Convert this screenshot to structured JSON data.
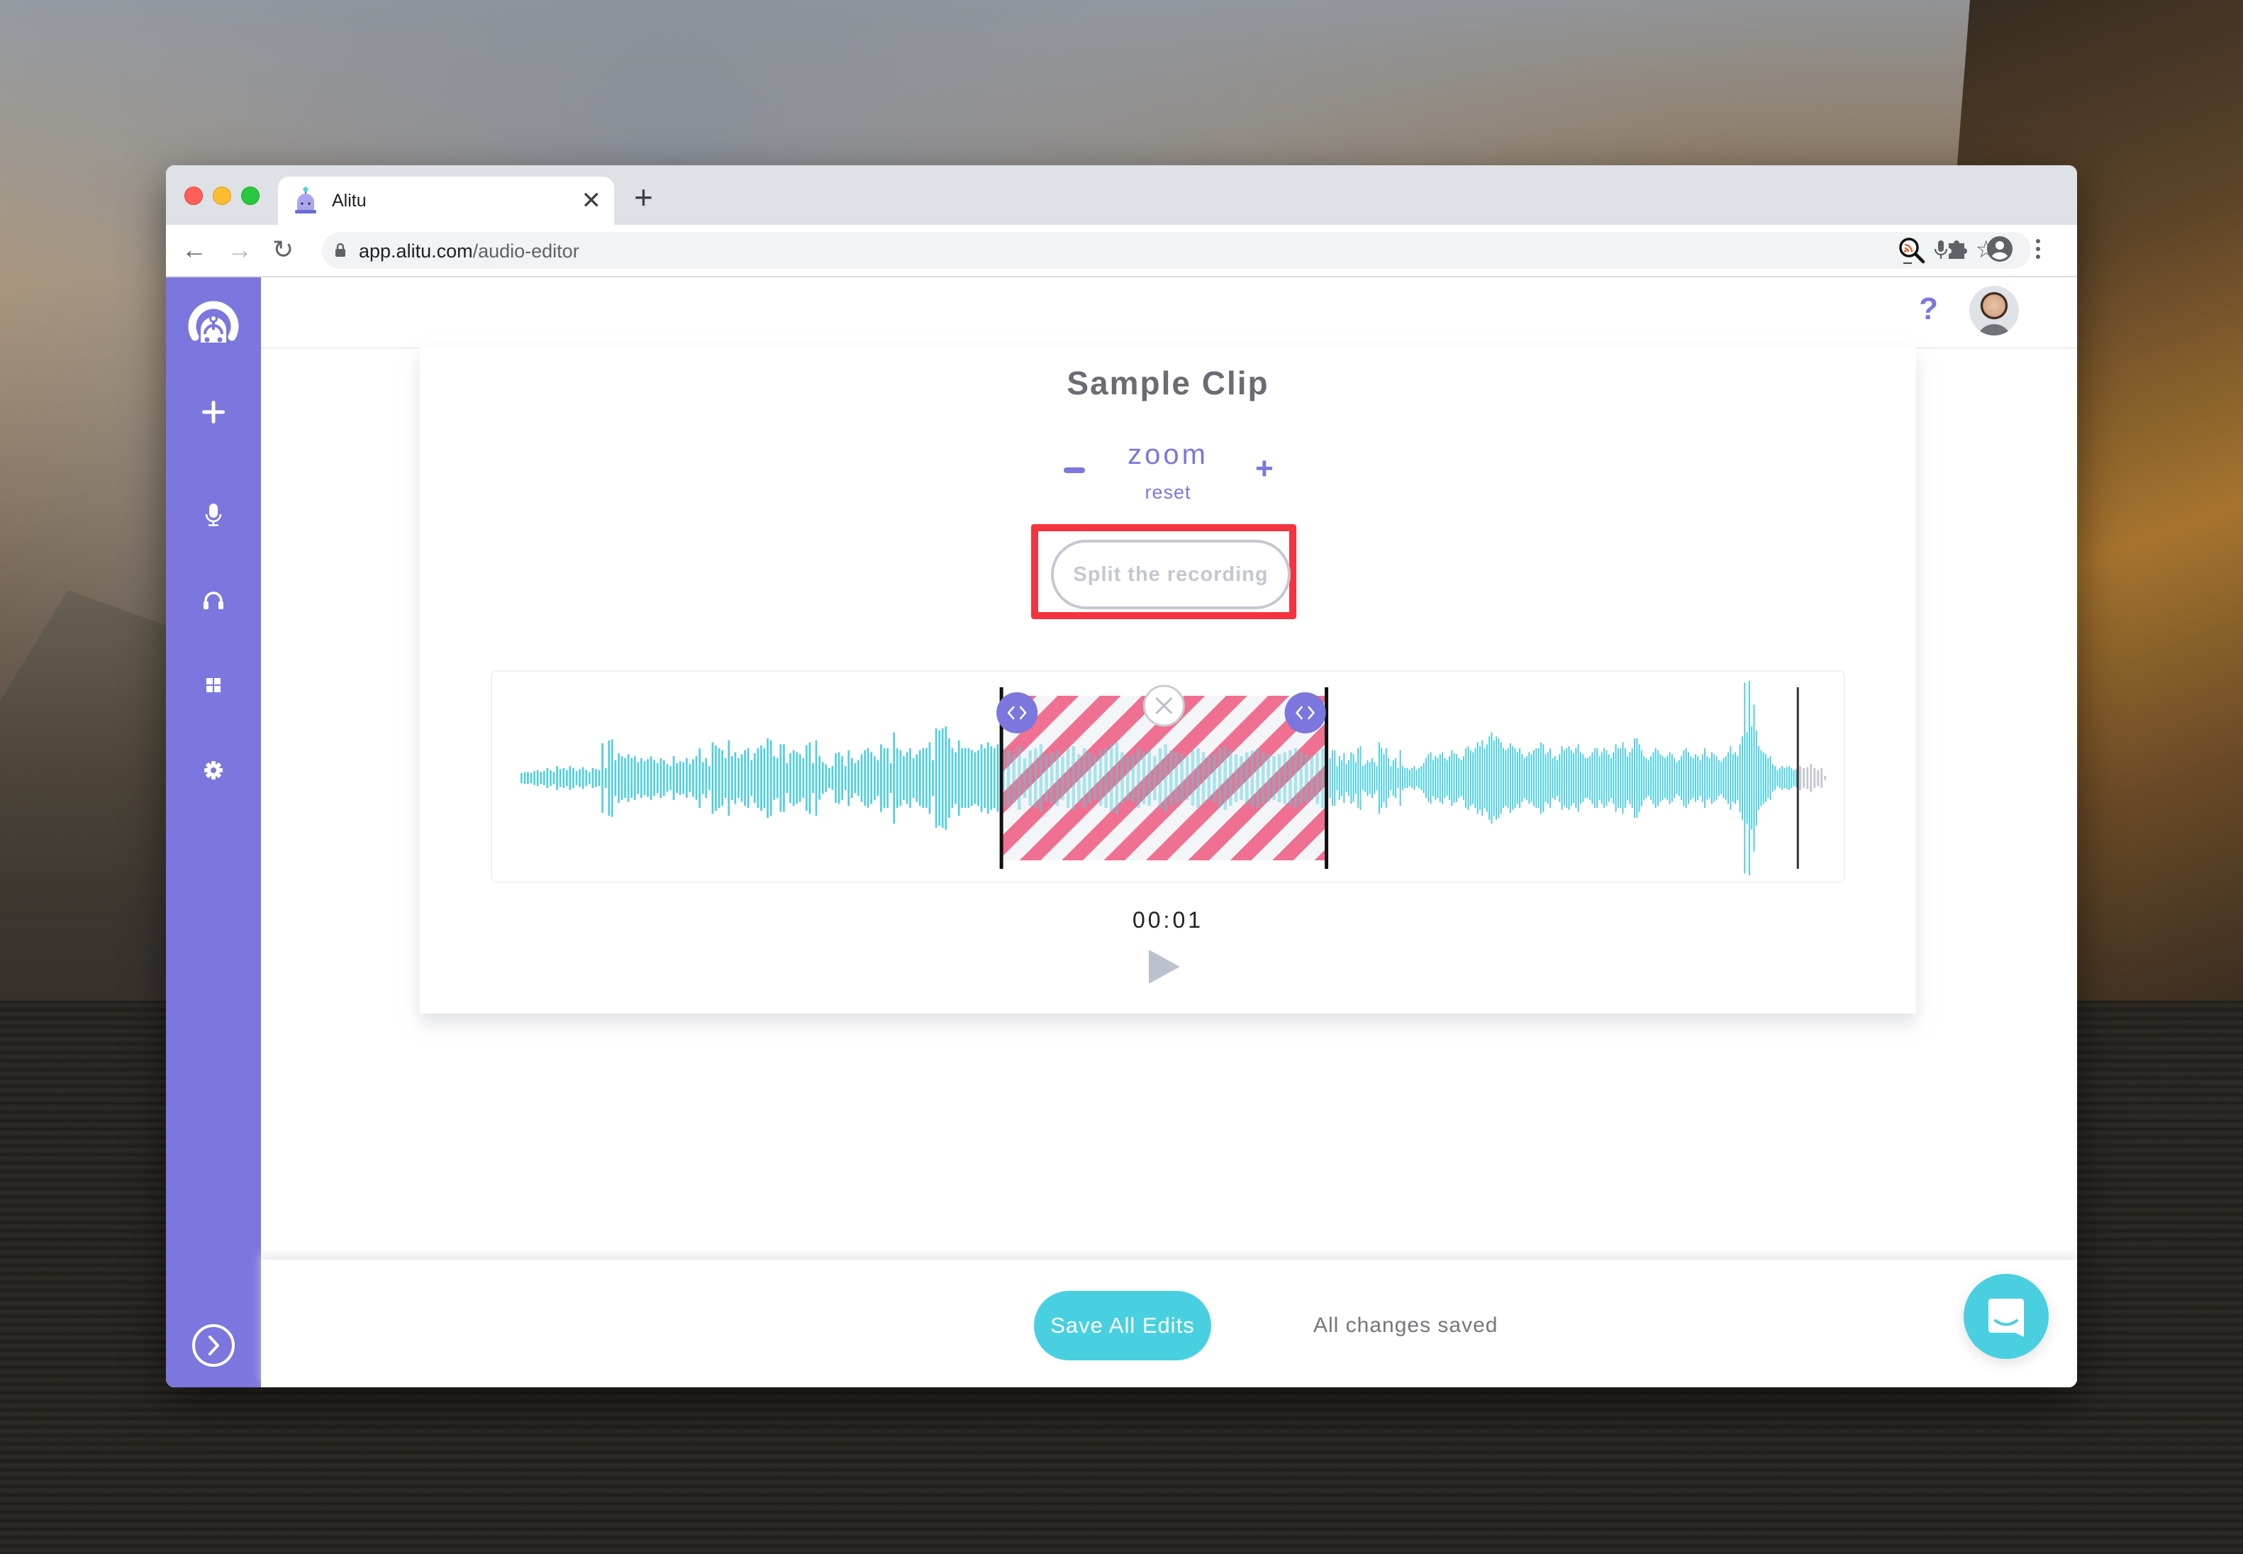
{
  "browser": {
    "tab_title": "Alitu",
    "url_host": "app.alitu.com",
    "url_path": "/audio-editor",
    "icons": {
      "tab_favicon": "alitu-robot-icon",
      "tab_close": "close-icon",
      "new_tab": "plus-icon",
      "back": "arrow-left-icon",
      "forward": "arrow-right-icon",
      "reload": "reload-icon",
      "lock": "lock-icon",
      "mic": "microphone-icon",
      "bookmark": "star-icon",
      "extension_podcast": "podcast-search-icon",
      "extensions": "puzzle-icon",
      "profile": "account-circle-icon",
      "menu": "kebab-menu-icon"
    },
    "glyphs": {
      "back": "←",
      "forward": "→",
      "reload": "↻",
      "star": "☆",
      "tab_close": "✕",
      "new_tab": "+"
    }
  },
  "sidebar": {
    "accent": "#7b77de",
    "items": [
      {
        "name": "logo",
        "icon": "alitu-logo-icon"
      },
      {
        "name": "add",
        "icon": "plus-icon"
      },
      {
        "name": "record",
        "icon": "microphone-icon"
      },
      {
        "name": "listen",
        "icon": "headphones-icon"
      },
      {
        "name": "dashboard",
        "icon": "grid-icon"
      },
      {
        "name": "settings",
        "icon": "gear-icon"
      },
      {
        "name": "expand",
        "icon": "chevron-right-circle-icon"
      }
    ]
  },
  "topbar": {
    "help_label": "?",
    "avatar": "user-avatar"
  },
  "editor": {
    "title": "Sample Clip",
    "zoom_label": "zoom",
    "zoom_reset_label": "reset",
    "zoom_minus_label": "−",
    "zoom_plus_label": "+",
    "split_button_label": "Split the recording",
    "split_button_highlighted": true,
    "current_time": "00:01",
    "colors": {
      "waveform": "#4fcfdf",
      "waveform_after_end": "#c8c8d2",
      "selection_stripe": "#ef7090",
      "handle": "#7b77de"
    },
    "waveform": {
      "amplitudes": [
        0.05,
        0.06,
        0.06,
        0.05,
        0.07,
        0.08,
        0.06,
        0.07,
        0.1,
        0.08,
        0.06,
        0.12,
        0.09,
        0.1,
        0.08,
        0.12,
        0.1,
        0.07,
        0.09,
        0.11,
        0.08,
        0.06,
        0.1,
        0.09,
        0.08,
        0.35,
        0.1,
        0.38,
        0.39,
        0.18,
        0.25,
        0.22,
        0.2,
        0.24,
        0.2,
        0.22,
        0.16,
        0.2,
        0.17,
        0.19,
        0.22,
        0.18,
        0.15,
        0.2,
        0.18,
        0.14,
        0.12,
        0.22,
        0.15,
        0.17,
        0.16,
        0.2,
        0.14,
        0.19,
        0.22,
        0.3,
        0.16,
        0.2,
        0.12,
        0.36,
        0.33,
        0.3,
        0.28,
        0.2,
        0.38,
        0.22,
        0.26,
        0.2,
        0.24,
        0.28,
        0.3,
        0.18,
        0.25,
        0.3,
        0.33,
        0.3,
        0.4,
        0.38,
        0.22,
        0.2,
        0.34,
        0.34,
        0.15,
        0.25,
        0.28,
        0.26,
        0.24,
        0.2,
        0.33,
        0.36,
        0.15,
        0.38,
        0.22,
        0.16,
        0.14,
        0.1,
        0.12,
        0.25,
        0.26,
        0.22,
        0.12,
        0.28,
        0.2,
        0.15,
        0.18,
        0.24,
        0.28,
        0.3,
        0.26,
        0.22,
        0.18,
        0.34,
        0.3,
        0.3,
        0.15,
        0.46,
        0.3,
        0.28,
        0.22,
        0.26,
        0.3,
        0.2,
        0.24,
        0.28,
        0.3,
        0.3,
        0.36,
        0.18,
        0.5,
        0.48,
        0.5,
        0.52,
        0.4,
        0.3,
        0.26,
        0.38,
        0.3,
        0.3,
        0.3,
        0.28,
        0.26,
        0.28,
        0.34,
        0.3,
        0.36,
        0.32,
        0.3,
        0.34
      ],
      "selected_amplitudes": [
        0.3,
        0.28,
        0.25,
        0.32,
        0.2,
        0.28,
        0.3,
        0.34,
        0.24,
        0.26,
        0.28,
        0.22,
        0.3,
        0.32,
        0.24,
        0.3,
        0.26,
        0.22,
        0.28,
        0.3,
        0.34,
        0.36,
        0.26,
        0.22,
        0.24,
        0.3,
        0.26,
        0.28,
        0.22,
        0.3,
        0.34,
        0.28,
        0.26,
        0.24,
        0.22,
        0.28,
        0.3,
        0.26,
        0.22,
        0.24,
        0.3,
        0.32,
        0.28,
        0.24,
        0.22,
        0.26,
        0.28,
        0.3,
        0.26,
        0.24,
        0.22,
        0.24,
        0.26,
        0.28,
        0.3,
        0.26,
        0.24,
        0.22,
        0.26,
        0.3
      ],
      "after_amplitudes": [
        0.2,
        0.28,
        0.28,
        0.12,
        0.22,
        0.18,
        0.25,
        0.14,
        0.18,
        0.26,
        0.24,
        0.16,
        0.3,
        0.32,
        0.12,
        0.14,
        0.18,
        0.16,
        0.2,
        0.16,
        0.12,
        0.36,
        0.3,
        0.24,
        0.3,
        0.2,
        0.12,
        0.18,
        0.2,
        0.1,
        0.28,
        0.12,
        0.1,
        0.1,
        0.08,
        0.1,
        0.12,
        0.08,
        0.1,
        0.12,
        0.15,
        0.2,
        0.24,
        0.26,
        0.18,
        0.22,
        0.2,
        0.24,
        0.26,
        0.2,
        0.18,
        0.22,
        0.28,
        0.25,
        0.24,
        0.2,
        0.18,
        0.22,
        0.3,
        0.32,
        0.28,
        0.26,
        0.3,
        0.36,
        0.32,
        0.38,
        0.3,
        0.34,
        0.42,
        0.46,
        0.38,
        0.42,
        0.4,
        0.36,
        0.3,
        0.28,
        0.3,
        0.35,
        0.32,
        0.3,
        0.26,
        0.3,
        0.24,
        0.2,
        0.22,
        0.26,
        0.24,
        0.28,
        0.3,
        0.3,
        0.36,
        0.34,
        0.24,
        0.26,
        0.3,
        0.2,
        0.22,
        0.18,
        0.24,
        0.32,
        0.28,
        0.3,
        0.32,
        0.28,
        0.25,
        0.3,
        0.34,
        0.26,
        0.24,
        0.2,
        0.2,
        0.22,
        0.26,
        0.3,
        0.3,
        0.22,
        0.26,
        0.3,
        0.28,
        0.24,
        0.2,
        0.26,
        0.34,
        0.3,
        0.3,
        0.36,
        0.3,
        0.22,
        0.26,
        0.3,
        0.4,
        0.4,
        0.34,
        0.28,
        0.22,
        0.2,
        0.18,
        0.22,
        0.26,
        0.3,
        0.28,
        0.24,
        0.22,
        0.2,
        0.22,
        0.26,
        0.24,
        0.2,
        0.16,
        0.18,
        0.22,
        0.28,
        0.3,
        0.26,
        0.22,
        0.2,
        0.24,
        0.22,
        0.18,
        0.24,
        0.3,
        0.22,
        0.2,
        0.26,
        0.24,
        0.22,
        0.18,
        0.16,
        0.2,
        0.22,
        0.26,
        0.32,
        0.24,
        0.26,
        0.22,
        0.34,
        0.42,
        0.96,
        0.46,
        0.98,
        0.52,
        0.74,
        0.48,
        0.32,
        0.28,
        0.26,
        0.24,
        0.2,
        0.22,
        0.14,
        0.12,
        0.08,
        0.1,
        0.12,
        0.1,
        0.11,
        0.12,
        0.1,
        0.08,
        0.09
      ],
      "trailing_amplitudes": [
        0.12,
        0.1,
        0.11,
        0.14,
        0.1,
        0.08,
        0.1,
        0.02
      ],
      "selection": {
        "start_fraction": 0.376,
        "end_fraction": 0.616
      },
      "end_marker_fraction": 0.964
    }
  },
  "footer": {
    "save_button_label": "Save All Edits",
    "status_text": "All changes saved",
    "chat_icon": "chat-bubble-icon"
  }
}
